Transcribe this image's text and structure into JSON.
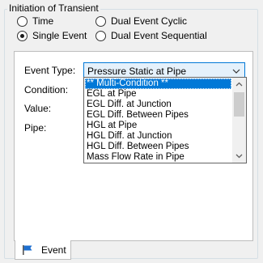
{
  "group": {
    "title": "Initiation of Transient"
  },
  "radios": [
    {
      "label": "Time",
      "checked": false
    },
    {
      "label": "Dual Event Cyclic",
      "checked": false
    },
    {
      "label": "Single Event",
      "checked": true
    },
    {
      "label": "Dual Event Sequential",
      "checked": false
    }
  ],
  "fields": {
    "event_type_label": "Event Type:",
    "event_type_value": "Pressure Static at Pipe",
    "condition_label": "Condition:",
    "value_label": "Value:",
    "pipe_label": "Pipe:"
  },
  "dropdown": {
    "selected_index": 0,
    "options": [
      "** Multi-Condition **",
      "EGL at Pipe",
      "EGL Diff. at Junction",
      "EGL Diff. Between Pipes",
      "HGL at Pipe",
      "HGL Diff. at Junction",
      "HGL Diff. Between Pipes",
      "Mass Flow Rate in Pipe"
    ]
  },
  "tab": {
    "label": "Event",
    "icon": "flag-icon"
  },
  "colors": {
    "selection": "#0078d7",
    "combo_focus": "#0078d7",
    "tab_icon": "#1e6fd0"
  }
}
